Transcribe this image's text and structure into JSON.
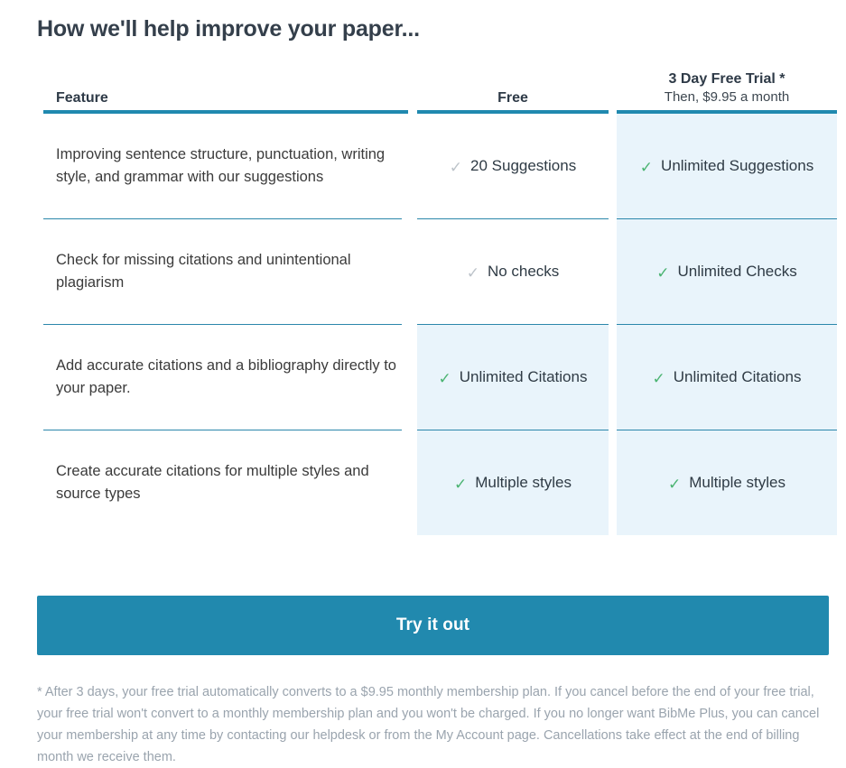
{
  "title": "How we'll help improve your paper...",
  "table": {
    "headers": {
      "feature": "Feature",
      "free": "Free",
      "trial_main": "3 Day Free Trial *",
      "trial_sub": "Then, $9.95 a month"
    },
    "rows": [
      {
        "feature": "Improving sentence structure, punctuation, writing style, and grammar with our suggestions",
        "free": {
          "text": "20 Suggestions",
          "check": "✓",
          "included": false,
          "highlight": false
        },
        "trial": {
          "text": "Unlimited Suggestions",
          "check": "✓",
          "included": true,
          "highlight": true
        }
      },
      {
        "feature": "Check for missing citations and unintentional plagiarism",
        "free": {
          "text": "No checks",
          "check": "✓",
          "included": false,
          "highlight": false
        },
        "trial": {
          "text": "Unlimited Checks",
          "check": "✓",
          "included": true,
          "highlight": true
        }
      },
      {
        "feature": "Add accurate citations and a bibliography directly to your paper.",
        "free": {
          "text": "Unlimited Citations",
          "check": "✓",
          "included": true,
          "highlight": true
        },
        "trial": {
          "text": "Unlimited Citations",
          "check": "✓",
          "included": true,
          "highlight": true
        }
      },
      {
        "feature": "Create accurate citations for multiple styles and source types",
        "free": {
          "text": "Multiple styles",
          "check": "✓",
          "included": true,
          "highlight": true
        },
        "trial": {
          "text": "Multiple styles",
          "check": "✓",
          "included": true,
          "highlight": true
        }
      }
    ]
  },
  "cta": {
    "label": "Try it out"
  },
  "footnote": "* After 3 days, your free trial automatically converts to a $9.95 monthly membership plan. If you cancel before the end of your free trial, your free trial won't convert to a monthly membership plan and you won't be charged. If you no longer want BibMe Plus, you can cancel your membership at any time by contacting our helpdesk or from the My Account page. Cancellations take effect at the end of billing month we receive them.",
  "colors": {
    "accent_teal": "#2189ae",
    "rule_teal": "#2b87ab",
    "highlight_blue": "#e9f4fb",
    "check_green": "#4bb472",
    "check_grey": "#bdc4ca",
    "title_dark": "#343f4b",
    "footnote_grey": "#9aa4ae"
  }
}
